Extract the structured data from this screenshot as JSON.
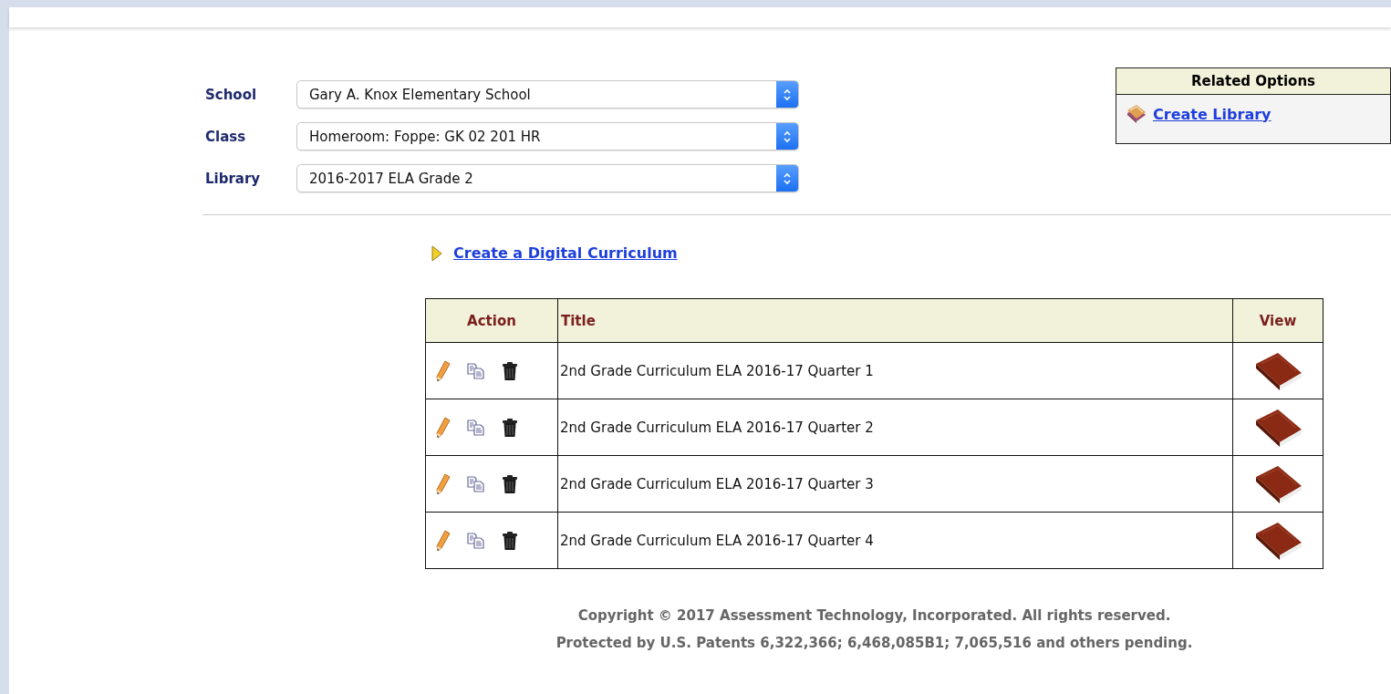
{
  "filters": [
    {
      "label": "School",
      "value": "Gary A. Knox Elementary School"
    },
    {
      "label": "Class",
      "value": "Homeroom: Foppe: GK 02 201 HR"
    },
    {
      "label": "Library",
      "value": "2016-2017 ELA Grade 2"
    }
  ],
  "related_options": {
    "title": "Related Options",
    "links": [
      "Create Library"
    ]
  },
  "create_link": "Create a Digital Curriculum",
  "table": {
    "columns": [
      "Action",
      "Title",
      "View"
    ],
    "rows": [
      {
        "title": "2nd Grade Curriculum ELA 2016-17 Quarter 1"
      },
      {
        "title": "2nd Grade Curriculum ELA 2016-17 Quarter 2"
      },
      {
        "title": "2nd Grade Curriculum ELA 2016-17 Quarter 3"
      },
      {
        "title": "2nd Grade Curriculum ELA 2016-17 Quarter 4"
      }
    ]
  },
  "footer": [
    "Copyright © 2017 Assessment Technology, Incorporated. All rights reserved.",
    "Protected by U.S. Patents 6,322,366; 6,468,085B1; 7,065,516 and others pending."
  ]
}
